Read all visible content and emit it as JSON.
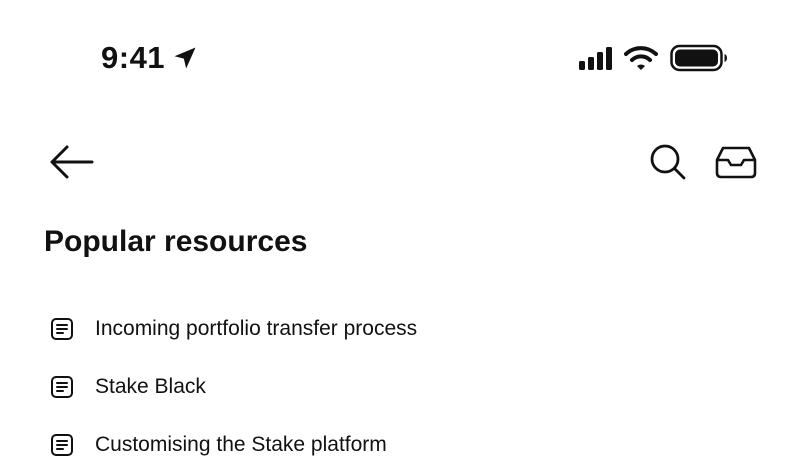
{
  "status_bar": {
    "time": "9:41",
    "icons": [
      "location-arrow-icon",
      "cellular-signal-icon",
      "wifi-icon",
      "battery-icon"
    ]
  },
  "nav": {
    "icons": [
      "back-arrow-icon",
      "search-icon",
      "inbox-icon"
    ]
  },
  "section": {
    "title": "Popular resources"
  },
  "resources": [
    {
      "label": "Incoming portfolio transfer process",
      "icon": "document-icon"
    },
    {
      "label": "Stake Black",
      "icon": "document-icon"
    },
    {
      "label": "Customising the Stake platform",
      "icon": "document-icon"
    }
  ],
  "colors": {
    "background": "#ffffff",
    "text": "#111111"
  }
}
